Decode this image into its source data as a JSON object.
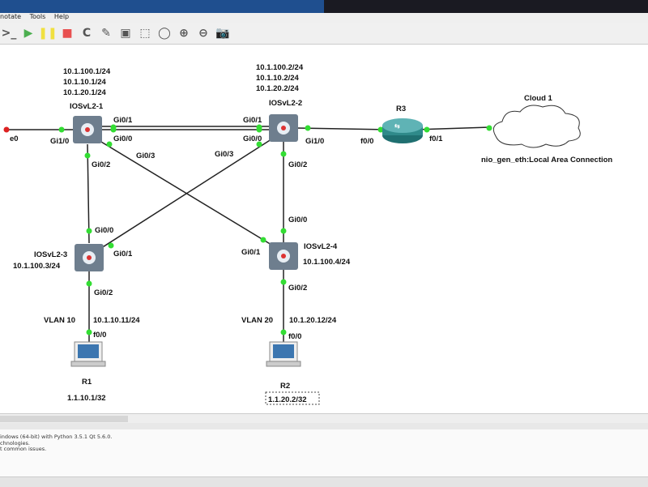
{
  "menu": [
    "notate",
    "Tools",
    "Help"
  ],
  "toolbar": [
    {
      "icon": "console-icon",
      "glyph": ">_"
    },
    {
      "icon": "play-icon",
      "glyph": "▶",
      "color": "#4caf50"
    },
    {
      "icon": "pause-icon",
      "glyph": "❚❚",
      "color": "#f0e040"
    },
    {
      "icon": "stop-icon",
      "glyph": "■",
      "color": "#e85050"
    },
    {
      "icon": "reload-icon",
      "glyph": "C"
    },
    {
      "icon": "note-icon",
      "glyph": "✎"
    },
    {
      "icon": "image-icon",
      "glyph": "▣"
    },
    {
      "icon": "rectangle-icon",
      "glyph": "⬚"
    },
    {
      "icon": "ellipse-icon",
      "glyph": "◯"
    },
    {
      "icon": "zoom-in-icon",
      "glyph": "⊕"
    },
    {
      "icon": "zoom-out-icon",
      "glyph": "⊖"
    },
    {
      "icon": "screenshot-icon",
      "glyph": "📷"
    }
  ],
  "nodes": {
    "sw1": {
      "name": "IOSvL2-1",
      "addr": [
        "10.1.100.1/24",
        "10.1.10.1/24",
        "10.1.20.1/24"
      ]
    },
    "sw2": {
      "name": "IOSvL2-2",
      "addr": [
        "10.1.100.2/24",
        "10.1.10.2/24",
        "10.1.20.2/24"
      ]
    },
    "r3": {
      "name": "R3"
    },
    "cloud": {
      "name": "Cloud 1",
      "iface": "nio_gen_eth:Local Area Connection"
    },
    "sw3": {
      "name": "IOSvL2-3",
      "addr": "10.1.100.3/24"
    },
    "sw4": {
      "name": "IOSvL2-4",
      "addr": "10.1.100.4/24"
    },
    "r1": {
      "name": "R1",
      "addr": "1.1.10.1/32",
      "vlan": "VLAN 10",
      "ip": "10.1.10.11/24"
    },
    "r2": {
      "name": "R2",
      "addr": "1.1.20.2/32",
      "vlan": "VLAN 20",
      "ip": "10.1.20.12/24"
    }
  },
  "ports": {
    "e0": "e0",
    "sw1_gi10": "Gi1/0",
    "sw1_gi01": "Gi0/1",
    "sw1_gi00": "Gi0/0",
    "sw1_gi02": "Gi0/2",
    "sw1_gi03": "Gi0/3",
    "sw2_gi01": "Gi0/1",
    "sw2_gi00": "Gi0/0",
    "sw2_gi10": "Gi1/0",
    "sw2_gi03": "Gi0/3",
    "sw2_gi02": "Gi0/2",
    "r3_f00": "f0/0",
    "r3_f01": "f0/1",
    "sw3_gi00": "Gi0/0",
    "sw3_gi01": "Gi0/1",
    "sw3_gi02": "Gi0/2",
    "sw4_gi00": "Gi0/0",
    "sw4_gi01": "Gi0/1",
    "sw4_gi02": "Gi0/2",
    "r1_f00": "f0/0",
    "r2_f00": "f0/0"
  },
  "console": [
    "indows (64-bit) with Python 3.5.1 Qt 5.6.0.",
    "chnologies.",
    "t common issues."
  ],
  "colors": {
    "link": "#222222",
    "port_up": "#33dd33",
    "port_down": "#dd2222",
    "switch": "#6e7e8e",
    "router": "#2f8a8a"
  }
}
